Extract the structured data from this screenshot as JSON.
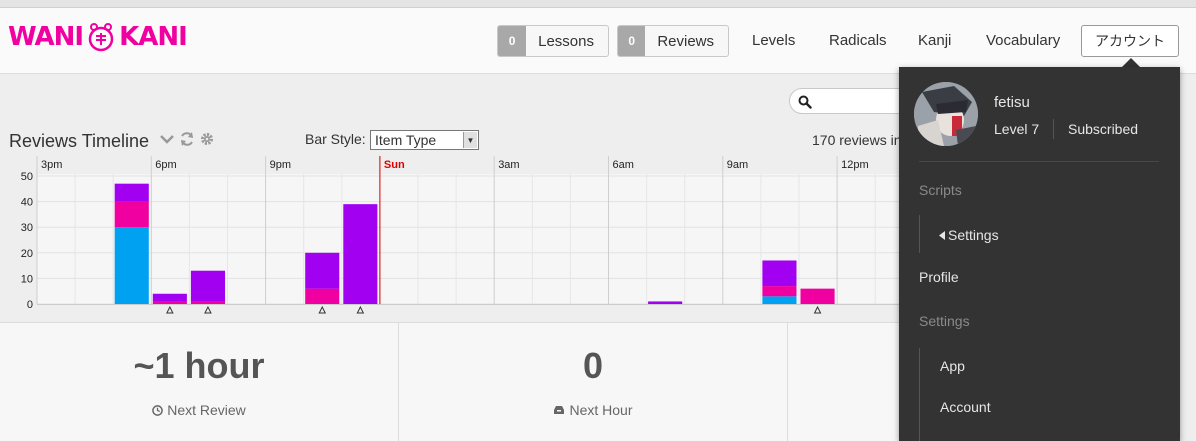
{
  "header": {
    "logo_left": "WANI",
    "logo_right": "KANI",
    "lessons": {
      "count": "0",
      "label": "Lessons"
    },
    "reviews": {
      "count": "0",
      "label": "Reviews"
    },
    "nav": [
      "Levels",
      "Radicals",
      "Kanji",
      "Vocabulary"
    ],
    "account_label": "アカウント"
  },
  "timeline": {
    "title": "Reviews Timeline",
    "bar_style_label": "Bar Style:",
    "bar_style_value": "Item Type",
    "reviews_in": "170 reviews in"
  },
  "chart_data": {
    "type": "bar",
    "stacked": true,
    "x_tick_labels": [
      "3pm",
      "6pm",
      "9pm",
      "Sun",
      "3am",
      "6am",
      "9am",
      "12pm"
    ],
    "y_ticks": [
      0,
      10,
      20,
      30,
      40,
      50
    ],
    "ylim": [
      0,
      50
    ],
    "hours_from_start": [
      2,
      3,
      4,
      7,
      8,
      16,
      19,
      20
    ],
    "series": [
      {
        "color": "#00a1f1",
        "values": [
          30,
          0,
          0,
          0,
          0,
          0,
          3,
          0
        ]
      },
      {
        "color": "#f100a1",
        "values": [
          10,
          1,
          1,
          6,
          0,
          0,
          4,
          6
        ]
      },
      {
        "color": "#a100f1",
        "values": [
          7,
          3,
          12,
          14,
          39,
          1,
          10,
          0
        ]
      }
    ],
    "markers_at_hours": [
      3,
      4,
      7,
      8,
      20
    ],
    "grid": true,
    "colors": {
      "day_marker": "#dd0000"
    }
  },
  "panels": [
    {
      "value": "~1 hour",
      "label": "Next Review",
      "icon": "clock-icon"
    },
    {
      "value": "0",
      "label": "Next Hour",
      "icon": "inbox-icon"
    }
  ],
  "menu": {
    "username": "fetisu",
    "level": "Level 7",
    "subscription": "Subscribed",
    "scripts_heading": "Scripts",
    "scripts_settings": "Settings",
    "profile": "Profile",
    "settings_heading": "Settings",
    "app": "App",
    "account": "Account"
  },
  "colors": {
    "brand": "#f100a1",
    "radical": "#00a1f1",
    "kanji": "#f100a1",
    "vocabulary": "#a100f1",
    "menu_bg": "#333333"
  }
}
